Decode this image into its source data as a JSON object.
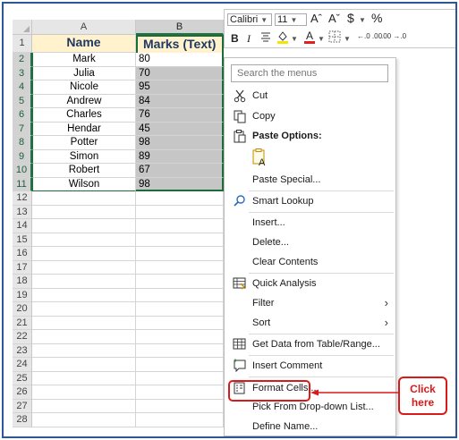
{
  "columns": {
    "a": "A",
    "b": "B"
  },
  "header": {
    "row": "1",
    "a": "Name",
    "b": "Marks (Text)"
  },
  "rows": [
    {
      "num": "2",
      "name": "Mark",
      "marks": "80"
    },
    {
      "num": "3",
      "name": "Julia",
      "marks": "70"
    },
    {
      "num": "4",
      "name": "Nicole",
      "marks": "95"
    },
    {
      "num": "5",
      "name": "Andrew",
      "marks": "84"
    },
    {
      "num": "6",
      "name": "Charles",
      "marks": "76"
    },
    {
      "num": "7",
      "name": "Hendar",
      "marks": "45"
    },
    {
      "num": "8",
      "name": "Potter",
      "marks": "98"
    },
    {
      "num": "9",
      "name": "Simon",
      "marks": "89"
    },
    {
      "num": "10",
      "name": "Robert",
      "marks": "67"
    },
    {
      "num": "11",
      "name": "Wilson",
      "marks": "98"
    }
  ],
  "empty_rows": [
    "12",
    "13",
    "14",
    "15",
    "16",
    "17",
    "18",
    "19",
    "20",
    "21",
    "22",
    "23",
    "24",
    "25",
    "26",
    "27",
    "28"
  ],
  "mini_toolbar": {
    "font": "Calibri",
    "size": "11",
    "increase_font": "Aˆ",
    "decrease_font": "Aˇ",
    "currency": "$",
    "percent": "%",
    "bold": "B",
    "italic": "I",
    "increase_decimal": "←.0 .00",
    "decrease_decimal": ".00 →.0"
  },
  "menu": {
    "search_placeholder": "Search the menus",
    "cut": "Cut",
    "copy": "Copy",
    "paste_options": "Paste Options:",
    "paste_special": "Paste Special...",
    "smart_lookup": "Smart Lookup",
    "insert": "Insert...",
    "delete": "Delete...",
    "clear_contents": "Clear Contents",
    "quick_analysis": "Quick Analysis",
    "filter": "Filter",
    "sort": "Sort",
    "get_data": "Get Data from Table/Range...",
    "insert_comment": "Insert Comment",
    "format_cells": "Format Cells...",
    "pick_dropdown": "Pick From Drop-down List...",
    "define_name": "Define Name..."
  },
  "callout": {
    "line1": "Click",
    "line2": "here"
  },
  "colors": {
    "header_fill": "#fff2cc",
    "header_text": "#1f3864",
    "selection_fill": "#c6c6c6",
    "selection_border": "#1e6b3a",
    "annotation_red": "#d91a1a",
    "frame_border": "#2f5597"
  }
}
